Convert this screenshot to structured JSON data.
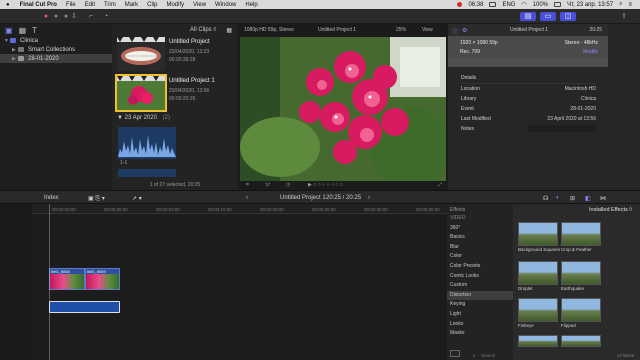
{
  "menubar": {
    "apple": "",
    "app": "Final Cut Pro",
    "items": [
      "File",
      "Edit",
      "Trim",
      "Mark",
      "Clip",
      "Modify",
      "View",
      "Window",
      "Help"
    ],
    "clock": "06:38",
    "locale": "ENG",
    "battery": "100%",
    "datetime": "Чт, 23 апр.  13:57"
  },
  "sidebar": {
    "library": "Clinica",
    "smart_collections": "Smart Collections",
    "event": "28-01-2020"
  },
  "browser": {
    "filter": "All Clips ◊",
    "clips": [
      {
        "title": "Untitled Project",
        "date": "23/04/2020, 13:23",
        "duration": "00:00:39:28"
      },
      {
        "title": "Untitled Project 1",
        "date": "23/04/2020, 13:56",
        "duration": "00:00:20:25"
      }
    ],
    "date_group": "23 Apr 2020",
    "date_group_count": "(2)",
    "audio_clip_label": "1-1",
    "status": "1 of 27 selected, 20:25"
  },
  "viewer": {
    "format": "1080p HD 59p, Stereo",
    "title": "Untitled Project 1",
    "zoom": "25%",
    "view_label": "View"
  },
  "inspector": {
    "title": "Untitled Project 1",
    "duration": "20:25",
    "format_line": "1920 × 1080 59p",
    "audio_line": "Stereo · 48kHz",
    "rec_line": "Rec. 709",
    "modify_label": "Modify",
    "section": "Details",
    "rows": [
      {
        "k": "Location",
        "v": "Macintosh HD"
      },
      {
        "k": "Library",
        "v": "Clinica"
      },
      {
        "k": "Event",
        "v": "28-01-2020"
      },
      {
        "k": "Last Modified",
        "v": "23 April 2020 at 13:56"
      }
    ],
    "notes_label": "Notes"
  },
  "timeline_bar": {
    "index": "Index",
    "project": "Untitled Project 1",
    "timecode": "20:25 / 20:25"
  },
  "timeline": {
    "ruler": [
      "00:00:00:00",
      "00:00:05:00",
      "00:00:10:00",
      "00:00:15:00",
      "00:00:20:00",
      "00:00:25:00",
      "00:00:30:00",
      "00:00:35:00",
      "00:00:40:00"
    ],
    "clips": [
      {
        "label": "IMG_6068"
      },
      {
        "label": "IMG_6069"
      }
    ]
  },
  "effects": {
    "header": "Effects",
    "section": "VIDEO",
    "categories": [
      "360°",
      "Basics",
      "Blur",
      "Color",
      "Color Presets",
      "Comic Looks",
      "Custom",
      "Distortion",
      "Keying",
      "Light",
      "Looks",
      "Masks"
    ],
    "selected": "Distortion",
    "grid_title": "Installed Effects ◊",
    "tiles": [
      "Background Squares",
      "Crop & Feather",
      "Droplet",
      "Earthquake",
      "Fisheye",
      "Flipped"
    ],
    "search_placeholder": "Search",
    "count": "17 items"
  }
}
